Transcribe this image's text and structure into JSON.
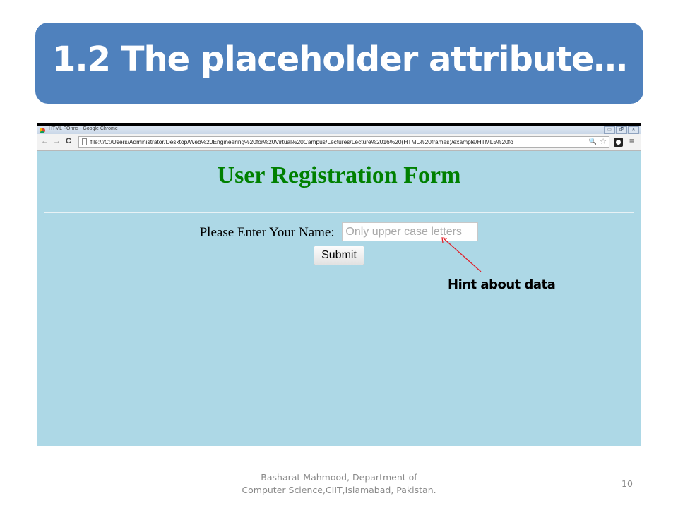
{
  "slide": {
    "title": "1.2 The placeholder attribute…",
    "annotation": "Hint about data",
    "footer_line1": "Basharat Mahmood, Department of",
    "footer_line2": "Computer Science,CIIT,Islamabad, Pakistan.",
    "page_number": "10",
    "colors": {
      "title_box": "#4f81bd",
      "page_background": "#add8e6",
      "heading_green": "#008000",
      "arrow_red": "#e0202a"
    }
  },
  "browser": {
    "window_title": "HTML FOrms - Google Chrome",
    "window_controls": {
      "minimize": "▭",
      "restore": "🗗",
      "close": "✕"
    },
    "toolbar": {
      "back_icon": "←",
      "forward_icon": "→",
      "reload_icon": "C",
      "url": "file:///C:/Users/Administrator/Desktop/Web%20Engineering%20for%20Virtual%20Campus/Lectures/Lecture%2016%20(HTML%20frames)/example/HTML5%20fo",
      "zoom_icon": "🔍",
      "bookmark_icon": "☆",
      "menu_icon": "≡"
    }
  },
  "page": {
    "heading": "User Registration Form",
    "name_label": "Please Enter Your Name:",
    "name_value": "",
    "name_placeholder": "Only upper case letters",
    "submit_label": "Submit"
  }
}
